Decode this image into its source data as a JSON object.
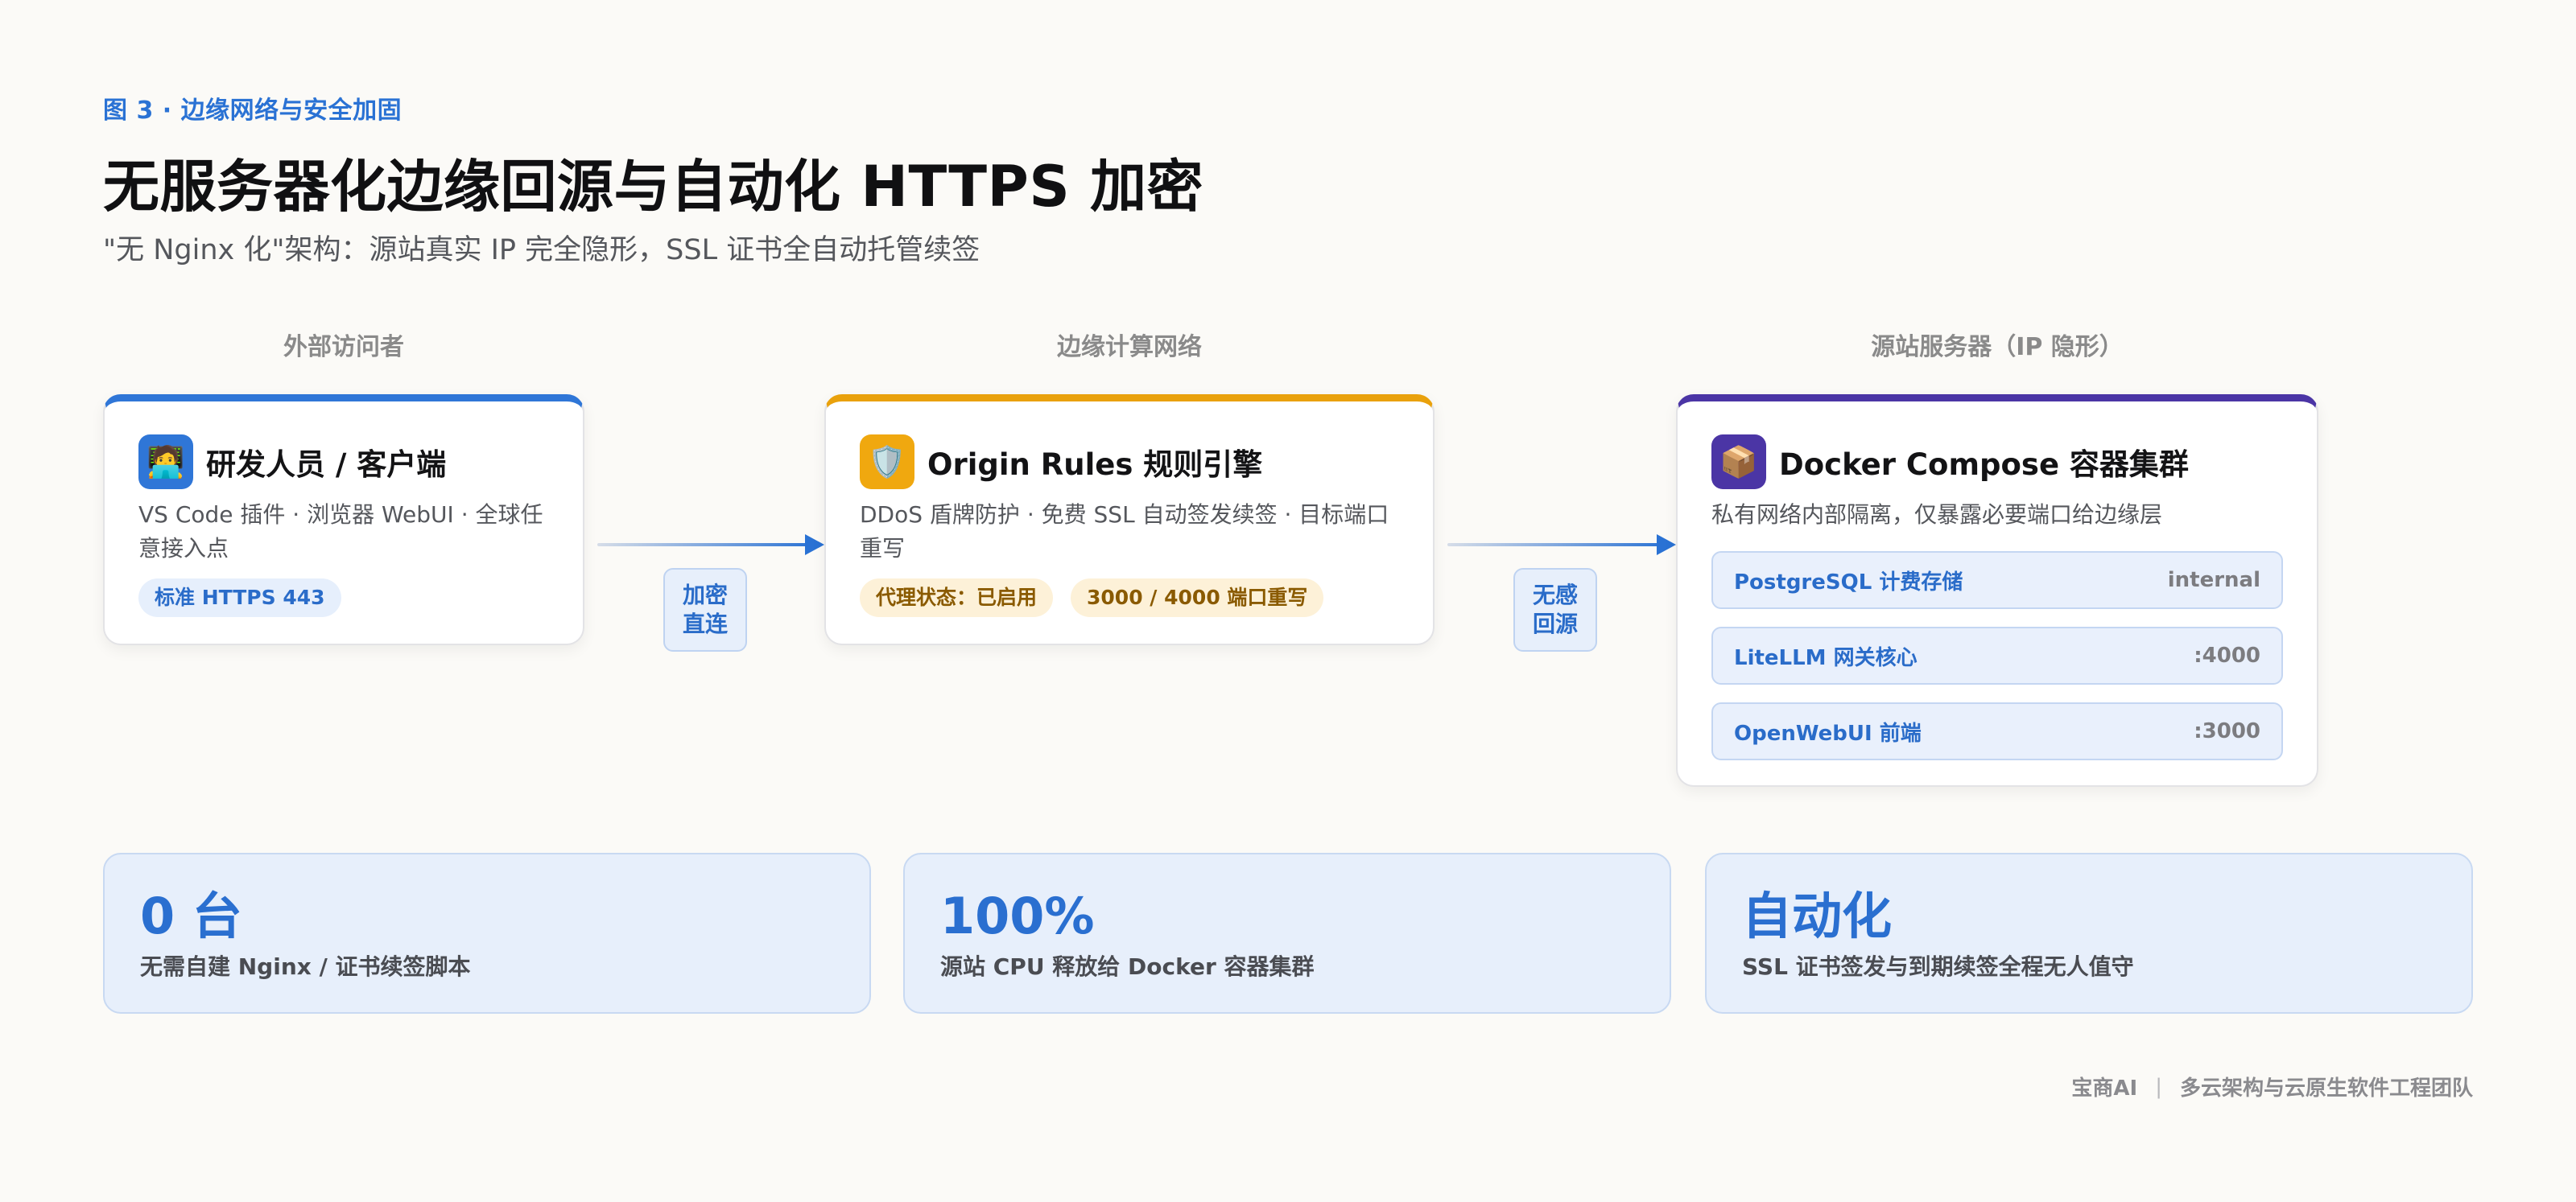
{
  "header": {
    "kicker": "图 3 · 边缘网络与安全加固",
    "title": "无服务器化边缘回源与自动化 HTTPS 加密",
    "subtitle": "\"无 Nginx 化\"架构：源站真实 IP 完全隐形，SSL 证书全自动托管续签"
  },
  "columns": {
    "left_label": "外部访问者",
    "mid_label": "边缘计算网络",
    "right_label": "源站服务器（IP 隐形）"
  },
  "client_card": {
    "icon": "technologist-emoji",
    "title": "研发人员 / 客户端",
    "desc": "VS Code 插件 · 浏览器 WebUI · 全球任意接入点",
    "pill": "标准 HTTPS 443"
  },
  "edge_card": {
    "icon": "shield-emoji",
    "title": "Origin Rules 规则引擎",
    "desc": "DDoS 盾牌防护 · 免费 SSL 自动签发续签 · 目标端口重写",
    "pill_status": "代理状态：已启用",
    "pill_ports": "3000 / 4000 端口重写"
  },
  "origin_card": {
    "icon": "package-emoji",
    "title": "Docker Compose 容器集群",
    "desc": "私有网络内部隔离，仅暴露必要端口给边缘层",
    "services": [
      {
        "name": "PostgreSQL 计费存储",
        "port": "internal"
      },
      {
        "name": "LiteLLM 网关核心",
        "port": ":4000"
      },
      {
        "name": "OpenWebUI 前端",
        "port": ":3000"
      }
    ]
  },
  "connectors": {
    "first": "加密直连",
    "second": "无感回源"
  },
  "stats": [
    {
      "value": "0 台",
      "label": "无需自建 Nginx / 证书续签脚本"
    },
    {
      "value": "100%",
      "label": "源站 CPU 释放给 Docker 容器集群"
    },
    {
      "value": "自动化",
      "label": "SSL 证书签发与到期续签全程无人值守"
    }
  ],
  "footer": {
    "brand": "宝商AI",
    "separator": "|",
    "team": "多云架构与云原生软件工程团队"
  },
  "colors": {
    "accent_blue": "#2f76d7",
    "accent_amber": "#e9a10c",
    "accent_purple": "#4b35a5",
    "background": "#fbfaf7"
  }
}
